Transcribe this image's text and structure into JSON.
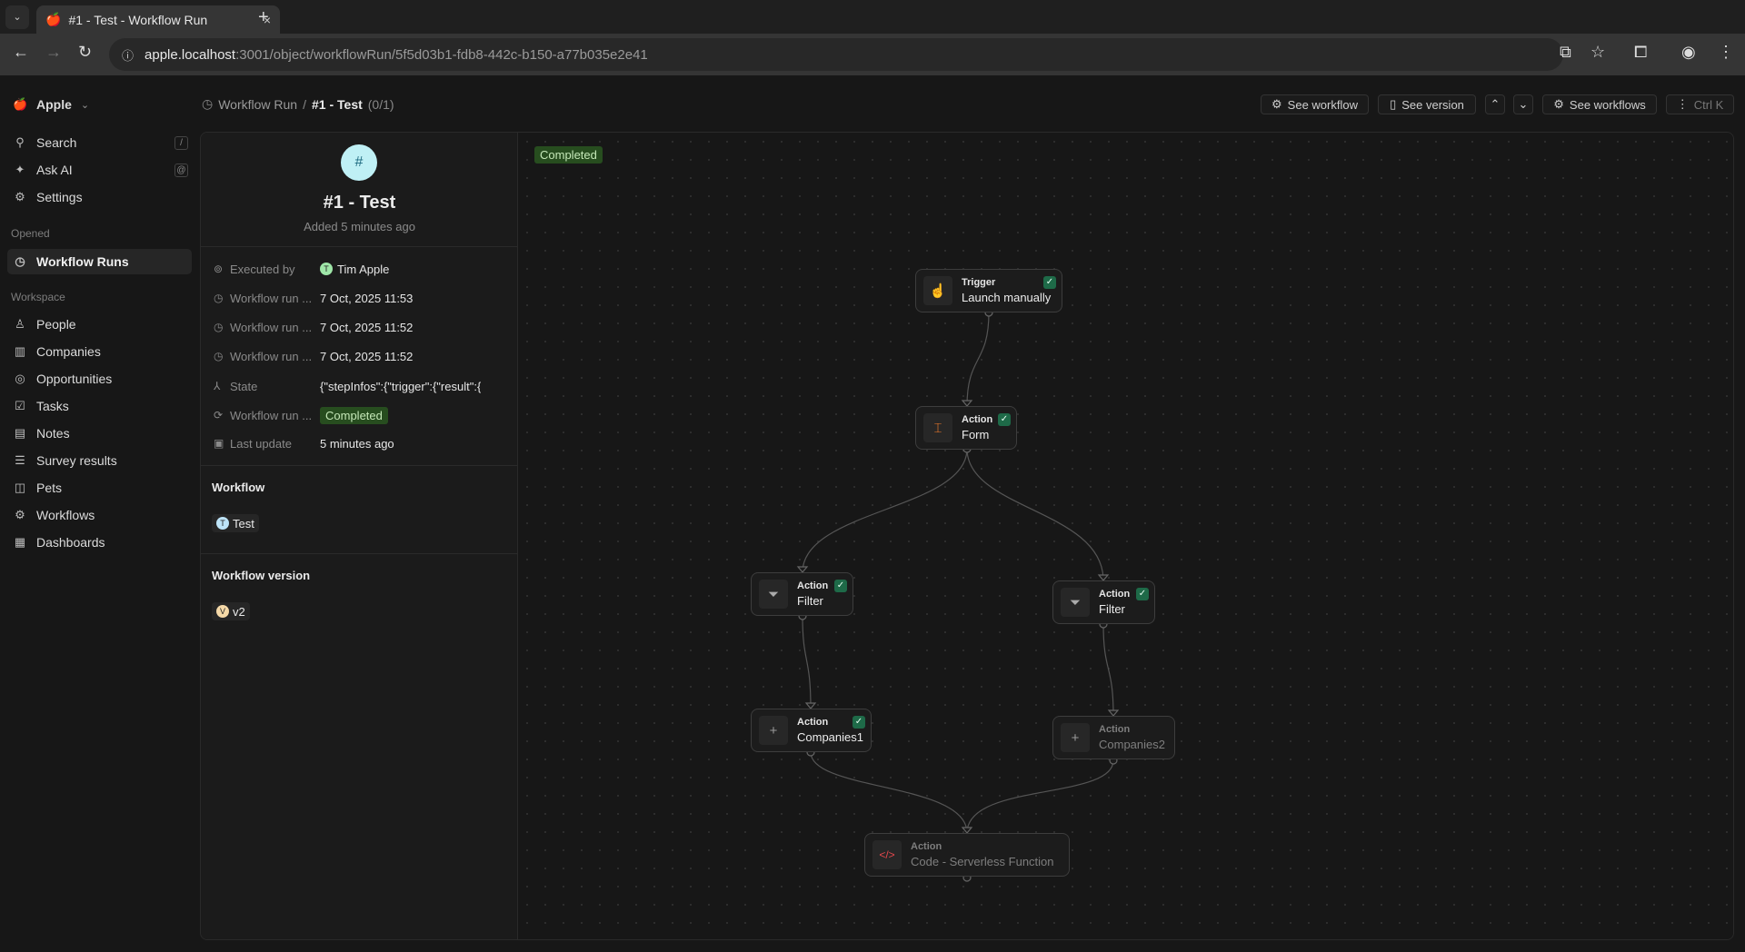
{
  "browser": {
    "tab_title": "#1 - Test - Workflow Run",
    "url_host": "apple.localhost",
    "url_path": ":3001/object/workflowRun/5f5d03b1-fdb8-442c-b150-a77b035e2e41"
  },
  "sidebar": {
    "workspace": "Apple",
    "search": "Search",
    "search_key": "/",
    "ask_ai": "Ask AI",
    "ask_ai_key": "@",
    "settings": "Settings",
    "opened_label": "Opened",
    "opened": [
      {
        "label": "Workflow Runs",
        "icon": "history-icon"
      }
    ],
    "workspace_label": "Workspace",
    "items": [
      {
        "label": "People",
        "icon": "user-icon"
      },
      {
        "label": "Companies",
        "icon": "building-icon"
      },
      {
        "label": "Opportunities",
        "icon": "target-icon"
      },
      {
        "label": "Tasks",
        "icon": "checkbox-icon"
      },
      {
        "label": "Notes",
        "icon": "notes-icon"
      },
      {
        "label": "Survey results",
        "icon": "table-icon"
      },
      {
        "label": "Pets",
        "icon": "cat-icon"
      },
      {
        "label": "Workflows",
        "icon": "settings-automation-icon"
      },
      {
        "label": "Dashboards",
        "icon": "dashboard-icon"
      }
    ]
  },
  "header": {
    "breadcrumb_parent": "Workflow Run",
    "separator": "/",
    "title": "#1 - Test",
    "count": "(0/1)",
    "buttons": {
      "see_workflow": "See workflow",
      "see_version": "See version",
      "see_workflows": "See workflows",
      "menu_shortcut": "Ctrl K"
    }
  },
  "record": {
    "avatar": "#",
    "title": "#1 - Test",
    "subtitle": "Added 5 minutes ago",
    "fields": [
      {
        "label": "Executed by",
        "value": "Tim Apple",
        "avatar": "T"
      },
      {
        "label": "Workflow run ...",
        "value": "7 Oct, 2025 11:53"
      },
      {
        "label": "Workflow run ...",
        "value": "7 Oct, 2025 11:52"
      },
      {
        "label": "Workflow run ...",
        "value": "7 Oct, 2025 11:52"
      },
      {
        "label": "State",
        "value": "{\"stepInfos\":{\"trigger\":{\"result\":{"
      },
      {
        "label": "Workflow run ...",
        "value": "Completed"
      },
      {
        "label": "Last update",
        "value": "5 minutes ago"
      }
    ],
    "workflow_label": "Workflow",
    "workflow": {
      "avatar": "T",
      "name": "Test"
    },
    "version_label": "Workflow version",
    "version": {
      "avatar": "V",
      "name": "v2"
    }
  },
  "canvas": {
    "status": "Completed",
    "nodes": [
      {
        "type": "Trigger",
        "name": "Launch manually",
        "done": true
      },
      {
        "type": "Action",
        "name": "Form",
        "done": true
      },
      {
        "type": "Action",
        "name": "Filter",
        "done": true
      },
      {
        "type": "Action",
        "name": "Filter",
        "done": true
      },
      {
        "type": "Action",
        "name": "Companies1",
        "done": true
      },
      {
        "type": "Action",
        "name": "Companies2",
        "done": false
      },
      {
        "type": "Action",
        "name": "Code - Serverless Function",
        "done": false
      }
    ]
  },
  "colors": {
    "completed_bg": "#274d1f",
    "check_bg": "#1e6a48",
    "accent_avatar": "#bff0f5"
  }
}
